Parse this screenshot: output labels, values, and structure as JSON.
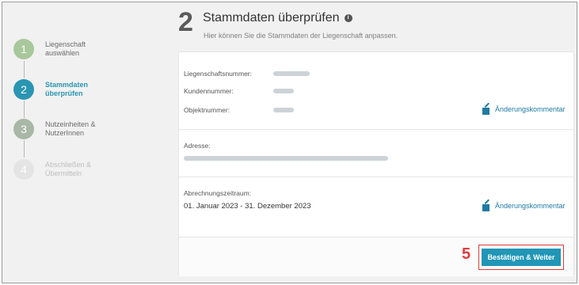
{
  "stepper": [
    {
      "number": "1",
      "label_line1": "Liegenschaft",
      "label_line2": "auswählen",
      "state": "done"
    },
    {
      "number": "2",
      "label_line1": "Stammdaten",
      "label_line2": "überprüfen",
      "state": "active"
    },
    {
      "number": "3",
      "label_line1": "Nutzeinheiten &",
      "label_line2": "NutzerInnen",
      "state": "todo"
    },
    {
      "number": "4",
      "label_line1": "Abschließen &",
      "label_line2": "Übermitteln",
      "state": "disabled"
    }
  ],
  "header": {
    "step_number": "2",
    "title": "Stammdaten überprüfen",
    "subtitle": "Hier können Sie die Stammdaten der Liegenschaft anpassen."
  },
  "fields": {
    "liegenschaftsnummer_label": "Liegenschaftsnummer:",
    "kundennummer_label": "Kundennummer:",
    "objektnummer_label": "Objektnummer:",
    "adresse_label": "Adresse:",
    "abrechnungszeitraum_label": "Abrechnungszeitraum:",
    "abrechnungszeitraum_value": "01. Januar 2023 - 31. Dezember 2023"
  },
  "actions": {
    "change_comment_label": "Änderungskommentar",
    "confirm_button_label": "Bestätigen & Weiter",
    "annotation_marker": "5"
  },
  "colors": {
    "accent": "#2196b6",
    "highlight": "#e23c3c",
    "step_done": "#a8c79b",
    "step_active": "#2a96b2"
  }
}
